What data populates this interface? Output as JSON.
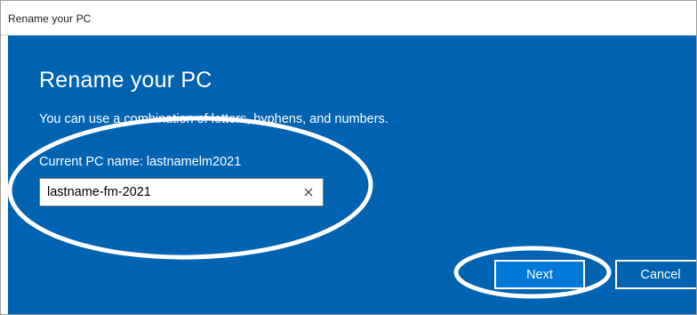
{
  "window": {
    "title": "Rename your PC"
  },
  "dialog": {
    "heading": "Rename your PC",
    "description": "You can use a combination of letters, hyphens, and numbers.",
    "current_name_label": "Current PC name: lastnamelm2021",
    "new_name_value": "lastname-fm-2021",
    "clear_icon": "close-icon"
  },
  "buttons": {
    "next_label": "Next",
    "cancel_label": "Cancel"
  },
  "annotations": {
    "stroke_color": "#ffffff"
  },
  "colors": {
    "panel_background": "#0063b1",
    "primary_button": "#0078d7",
    "text": "#ffffff"
  }
}
